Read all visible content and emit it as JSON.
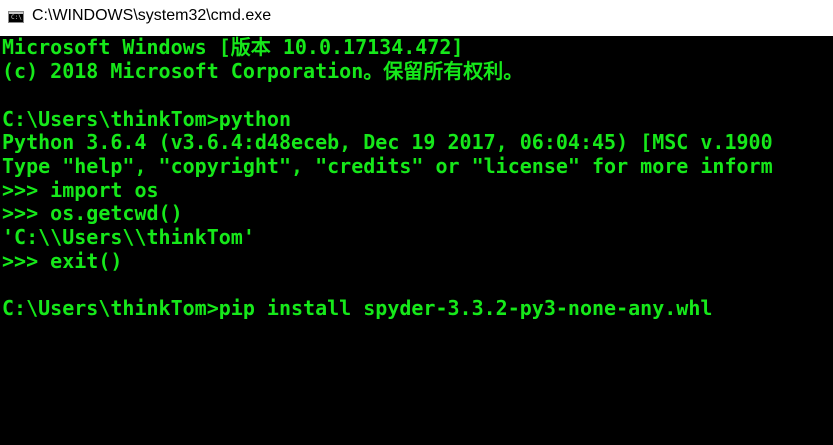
{
  "window": {
    "title": "C:\\WINDOWS\\system32\\cmd.exe",
    "icon": "cmd-icon",
    "icon_glyph": "C:\\"
  },
  "colors": {
    "console_background": "#000000",
    "console_text": "#16e81a",
    "titlebar_background": "#ffffff"
  },
  "console": {
    "lines": [
      "Microsoft Windows [版本 10.0.17134.472]",
      "(c) 2018 Microsoft Corporation。保留所有权利。",
      "",
      "C:\\Users\\thinkTom>python",
      "Python 3.6.4 (v3.6.4:d48eceb, Dec 19 2017, 06:04:45) [MSC v.1900",
      "Type \"help\", \"copyright\", \"credits\" or \"license\" for more inform",
      ">>> import os",
      ">>> os.getcwd()",
      "'C:\\\\Users\\\\thinkTom'",
      ">>> exit()",
      "",
      "C:\\Users\\thinkTom>pip install spyder-3.3.2-py3-none-any.whl"
    ]
  }
}
